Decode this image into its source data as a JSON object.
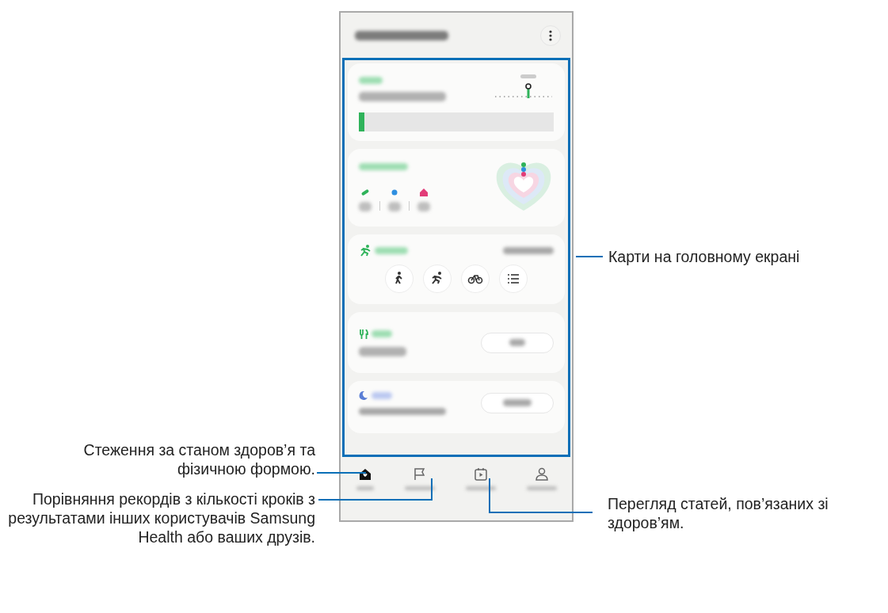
{
  "phone": {
    "cards": [
      {
        "kind": "steps",
        "level": 0.03
      },
      {
        "kind": "activity"
      },
      {
        "kind": "exercise"
      },
      {
        "kind": "food"
      },
      {
        "kind": "sleep"
      }
    ],
    "nav": [
      {
        "kind": "home",
        "selected": true
      },
      {
        "kind": "flag",
        "selected": false
      },
      {
        "kind": "video",
        "selected": false
      },
      {
        "kind": "person",
        "selected": false
      }
    ]
  },
  "callouts": [
    {
      "text": "Карти на головному екрані"
    },
    {
      "text": "Стеження за станом здоров’я та фізичною формою."
    },
    {
      "text": "Порівняння рекордів з кількості кроків з результатами інших користувачів Samsung Health або ваших друзів."
    },
    {
      "text": "Перегляд статей, пов’язаних зі здоров’ям."
    }
  ]
}
